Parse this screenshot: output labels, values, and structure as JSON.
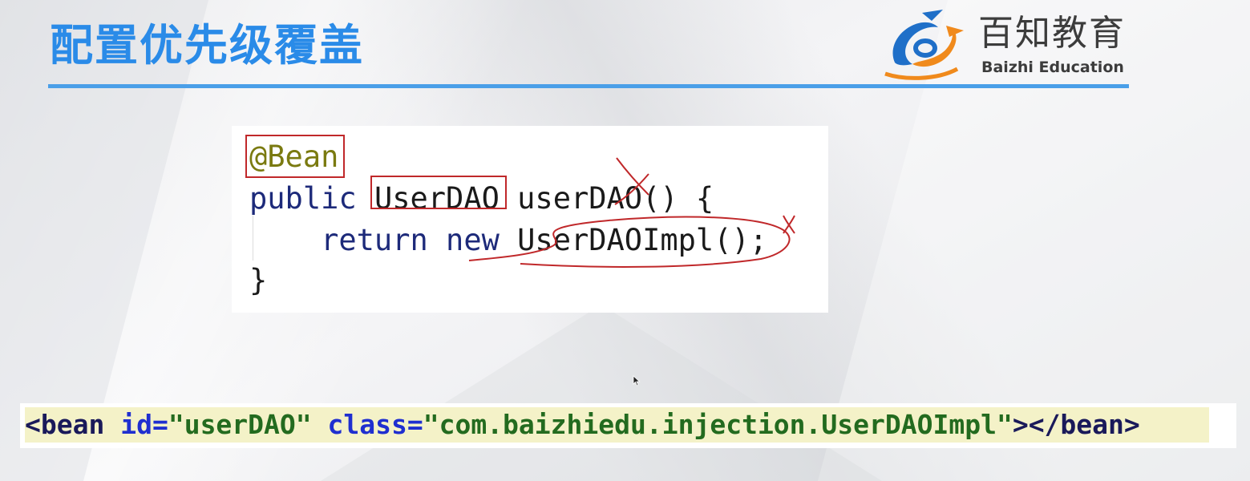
{
  "slide": {
    "title": "配置优先级覆盖",
    "accent_color": "#2a8be8",
    "rule_color": "#4a9fe8"
  },
  "logo": {
    "name_cn": "百知教育",
    "name_en": "Baizhi Education",
    "mark_icon": "baizhi-swirl-logo",
    "colors": {
      "blue": "#1f6fc8",
      "orange": "#f08a1c"
    }
  },
  "code": {
    "language": "java",
    "lines": [
      {
        "annotation": "@Bean"
      },
      {
        "keyword": "public ",
        "type": "UserDAO",
        "method": " userDAO() {"
      },
      {
        "indent": "    ",
        "keyword": "return new ",
        "value": "UserDAOImpl();"
      },
      {
        "text": "}"
      }
    ],
    "handwritten_marks": [
      "box-around-annotation",
      "box-around-return-type",
      "cross-over-method-name",
      "loop-around-new-expression",
      "cross-after-expression"
    ],
    "mark_color": "#c0282a"
  },
  "xml": {
    "open": "<bean ",
    "id_attr": "id=",
    "id_value": "\"userDAO\"",
    "class_attr": " class=",
    "class_value": "\"com.baizhiedu.injection.UserDAOImpl\"",
    "close": "></bean>",
    "highlight_color": "#f4f2c8"
  },
  "cursor_icon": "mouse-pointer-icon"
}
